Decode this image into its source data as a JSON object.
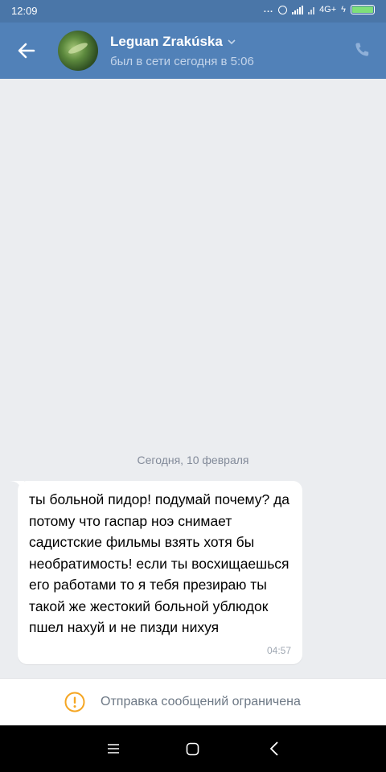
{
  "status_bar": {
    "time": "12:09",
    "dots": "...",
    "network": "4G+"
  },
  "header": {
    "contact_name": "Leguan Zrakúska",
    "contact_status": "был в сети сегодня в 5:06",
    "icons": [
      "back-arrow-icon",
      "chevron-down-icon",
      "phone-icon"
    ],
    "accent_color": "#5181b8"
  },
  "chat": {
    "date_separator": "Сегодня, 10 февраля",
    "messages": [
      {
        "text": "ты больной пидор! подумай почему? да потому что гаспар ноэ снимает садистские фильмы взять хотя бы необратимость! если ты восхищаешься его работами то я тебя презираю ты такой же жестокий больной ублюдок пшел нахуй и не пизди нихуя",
        "time": "04:57"
      }
    ]
  },
  "restriction": {
    "text": "Отправка сообщений ограничена",
    "icon": "warning-icon",
    "icon_color": "#f5a623"
  },
  "nav_bar": {
    "icons": [
      "menu-icon",
      "home-icon",
      "back-icon"
    ]
  }
}
